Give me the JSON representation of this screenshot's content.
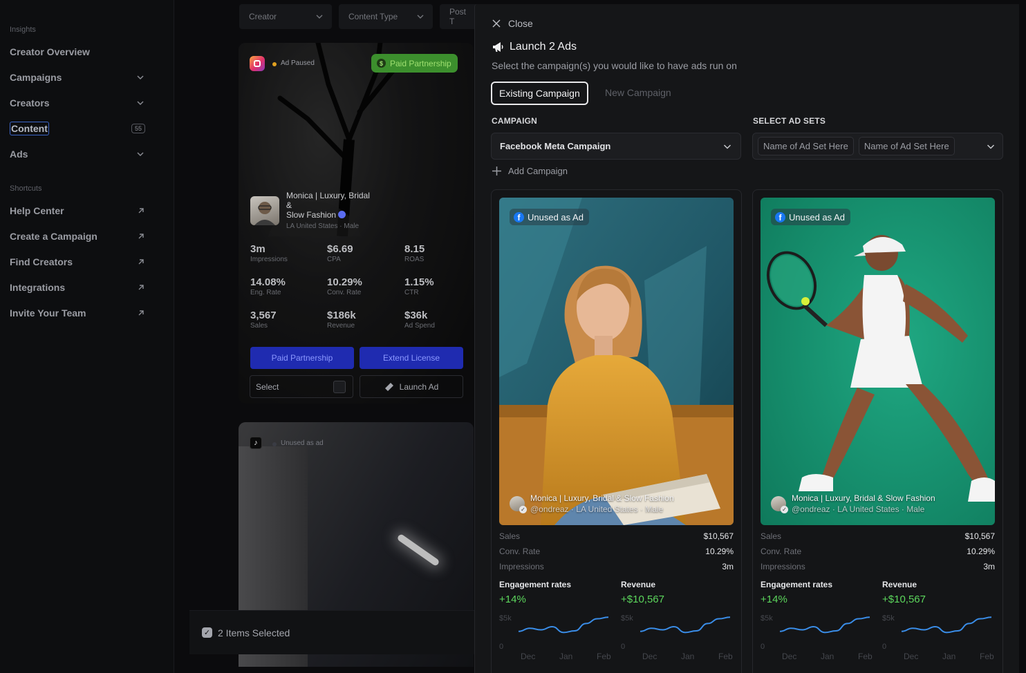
{
  "sidebar": {
    "insights_label": "Insights",
    "items": [
      {
        "label": "Creator Overview"
      },
      {
        "label": "Campaigns"
      },
      {
        "label": "Creators"
      },
      {
        "label": "Content",
        "count": "55"
      },
      {
        "label": "Ads"
      }
    ],
    "shortcuts_label": "Shortcuts",
    "shortcuts": [
      {
        "label": "Help Center"
      },
      {
        "label": "Create a Campaign"
      },
      {
        "label": "Find Creators"
      },
      {
        "label": "Integrations"
      },
      {
        "label": "Invite Your Team"
      }
    ]
  },
  "filters": [
    "Creator",
    "Content Type",
    "Post T"
  ],
  "bg_card": {
    "status": "Ad Paused",
    "partnership_pill": "Paid Partnership",
    "creator_name_line1": "Monica | Luxury, Bridal",
    "creator_name_line2": "&",
    "creator_name_line3": "Slow Fashion",
    "creator_loc": "LA United States  ·  Male",
    "stats": [
      {
        "value": "3m",
        "label": "Impressions"
      },
      {
        "value": "$6.69",
        "label": "CPA"
      },
      {
        "value": "8.15",
        "label": "ROAS"
      },
      {
        "value": "14.08%",
        "label": "Eng. Rate"
      },
      {
        "value": "10.29%",
        "label": "Conv. Rate"
      },
      {
        "value": "1.15%",
        "label": "CTR"
      },
      {
        "value": "3,567",
        "label": "Sales"
      },
      {
        "value": "$186k",
        "label": "Revenue"
      },
      {
        "value": "$36k",
        "label": "Ad Spend"
      }
    ],
    "paid_partnership_btn": "Paid Partnership",
    "extend_license_btn": "Extend License",
    "select_label": "Select",
    "launch_ad_btn": "Launch Ad"
  },
  "bg_card2": {
    "status": "Unused as ad"
  },
  "selection_bar": {
    "label": "2 Items Selected"
  },
  "drawer": {
    "close_label": "Close",
    "title": "Launch 2 Ads",
    "subtitle": "Select the campaign(s) you would like to have ads run on",
    "tab_existing": "Existing Campaign",
    "tab_new": "New Campaign",
    "campaign_label": "CAMPAIGN",
    "campaign_value": "Facebook Meta Campaign",
    "adsets_label": "SELECT AD SETS",
    "adset_chips": [
      "Name of Ad Set Here",
      "Name of Ad Set Here"
    ],
    "add_campaign": "Add Campaign",
    "cards": [
      {
        "badge": "Unused as Ad",
        "creator_name": "Monica | Luxury, Bridal & Slow Fashion",
        "creator_meta": "@ondreaz · LA United States  ·  Male",
        "metrics": [
          {
            "k": "Sales",
            "v": "$10,567"
          },
          {
            "k": "Conv. Rate",
            "v": "10.29%"
          },
          {
            "k": "Impressions",
            "v": "3m"
          }
        ],
        "charts": [
          {
            "title": "Engagement rates",
            "delta": "+14%",
            "ytop": "$5k",
            "ybot": "0",
            "x": [
              "Dec",
              "Jan",
              "Feb"
            ],
            "values": [
              2.0,
              2.6,
              2.3,
              2.9,
              1.8,
              2.1,
              3.5,
              4.4,
              4.7
            ]
          },
          {
            "title": "Revenue",
            "delta": "+$10,567",
            "ytop": "$5k",
            "ybot": "0",
            "x": [
              "Dec",
              "Jan",
              "Feb"
            ],
            "values": [
              2.0,
              2.6,
              2.3,
              2.9,
              1.8,
              2.1,
              3.5,
              4.4,
              4.7
            ]
          }
        ]
      },
      {
        "badge": "Unused as Ad",
        "creator_name": "Monica | Luxury, Bridal & Slow Fashion",
        "creator_meta": "@ondreaz · LA United States  ·  Male",
        "metrics": [
          {
            "k": "Sales",
            "v": "$10,567"
          },
          {
            "k": "Conv. Rate",
            "v": "10.29%"
          },
          {
            "k": "Impressions",
            "v": "3m"
          }
        ],
        "charts": [
          {
            "title": "Engagement rates",
            "delta": "+14%",
            "ytop": "$5k",
            "ybot": "0",
            "x": [
              "Dec",
              "Jan",
              "Feb"
            ],
            "values": [
              2.0,
              2.6,
              2.3,
              2.9,
              1.8,
              2.1,
              3.5,
              4.4,
              4.7
            ]
          },
          {
            "title": "Revenue",
            "delta": "+$10,567",
            "ytop": "$5k",
            "ybot": "0",
            "x": [
              "Dec",
              "Jan",
              "Feb"
            ],
            "values": [
              2.0,
              2.6,
              2.3,
              2.9,
              1.8,
              2.1,
              3.5,
              4.4,
              4.7
            ]
          }
        ]
      }
    ]
  },
  "colors": {
    "accent_blue": "#1f2bb0",
    "positive": "#5cd65c",
    "chart_line": "#3a8de8",
    "paid_green": "#3c8f2d"
  }
}
